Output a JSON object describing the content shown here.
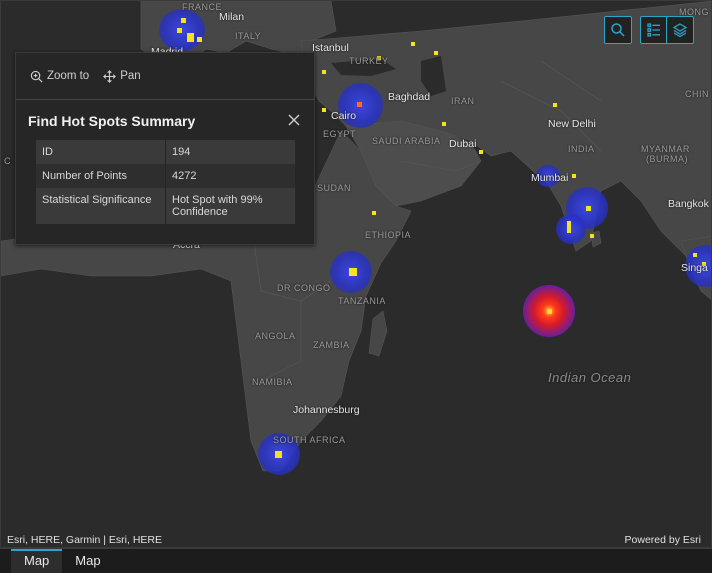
{
  "map": {
    "labels": {
      "france": "FRANCE",
      "milan": "Milan",
      "italy": "ITALY",
      "madrid": "Madrid",
      "istanbul": "Istanbul",
      "turkey": "TURKEY",
      "mongolia": "MONG",
      "china": "CHIN",
      "baghdad": "Baghdad",
      "iran": "IRAN",
      "cairo": "Cairo",
      "egypt": "EGYPT",
      "saudi": "SAUDI ARABIA",
      "dubai": "Dubai",
      "newdelhi": "New Delhi",
      "india": "INDIA",
      "myanmar1": "MYANMAR",
      "myanmar2": "(BURMA)",
      "mumbai": "Mumbai",
      "bangkok": "Bangkok",
      "singapore": "Singa",
      "sudan": "SUDAN",
      "ethiopia": "ETHIOPIA",
      "accra": "Accra",
      "drcongo": "DR CONGO",
      "tanzania": "TANZANIA",
      "angola": "ANGOLA",
      "zambia": "ZAMBIA",
      "namibia": "NAMIBIA",
      "johannesburg": "Johannesburg",
      "southafrica": "SOUTH AFRICA",
      "indianocean": "Indian Ocean",
      "c_edge": "C"
    },
    "attribution": "Esri, HERE, Garmin | Esri, HERE",
    "powered_by": "Powered by Esri",
    "colors": {
      "hot_spot_99": "#3540c8",
      "core": "#ff3a1a",
      "point": "#f3e41f",
      "accent": "#2aa6c8"
    }
  },
  "toolbar": {
    "search_icon": "search-icon",
    "legend_icon": "legend-list-icon",
    "layers_icon": "layers-icon"
  },
  "popup": {
    "zoom_to_label": "Zoom to",
    "pan_label": "Pan",
    "title": "Find Hot Spots Summary",
    "rows": [
      {
        "key": "ID",
        "value": "194"
      },
      {
        "key": "Number of Points",
        "value": "4272"
      },
      {
        "key": "Statistical Significance",
        "value": "Hot Spot with 99% Confidence"
      }
    ]
  },
  "tabs": [
    {
      "label": "Map",
      "active": true
    },
    {
      "label": "Map",
      "active": false
    }
  ]
}
